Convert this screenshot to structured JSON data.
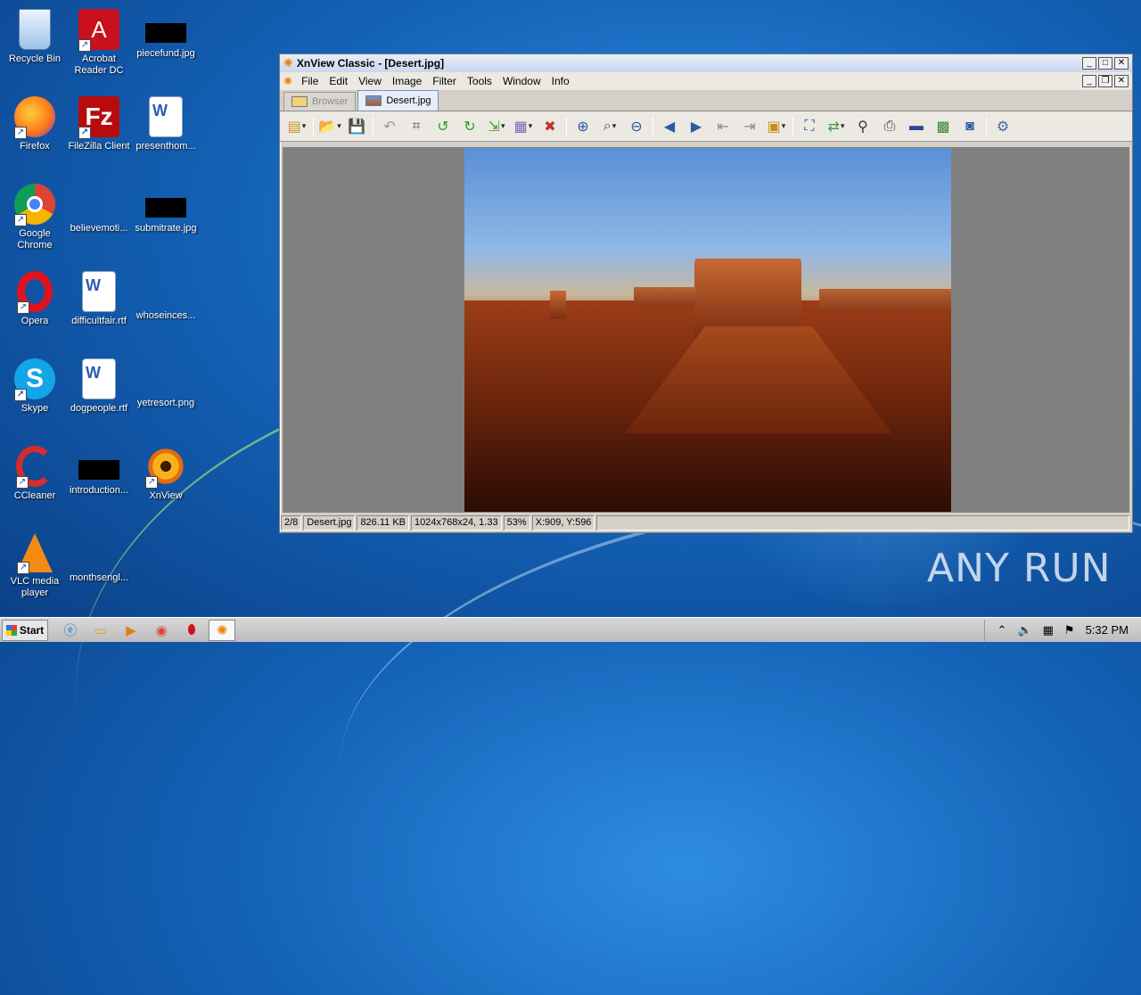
{
  "desktop": {
    "icons": [
      {
        "label": "Recycle Bin"
      },
      {
        "label": "Acrobat Reader DC"
      },
      {
        "label": "piecefund.jpg"
      },
      {
        "label": "Firefox"
      },
      {
        "label": "FileZilla Client"
      },
      {
        "label": "presenthom..."
      },
      {
        "label": "Google Chrome"
      },
      {
        "label": "believemoti..."
      },
      {
        "label": "submitrate.jpg"
      },
      {
        "label": "Opera"
      },
      {
        "label": "difficultfair.rtf"
      },
      {
        "label": "whoseinces..."
      },
      {
        "label": "Skype"
      },
      {
        "label": "dogpeople.rtf"
      },
      {
        "label": "yetresort.png"
      },
      {
        "label": "CCleaner"
      },
      {
        "label": "introduction..."
      },
      {
        "label": "XnView"
      },
      {
        "label": "VLC media player"
      },
      {
        "label": "monthsengl..."
      }
    ]
  },
  "window": {
    "title": "XnView Classic - [Desert.jpg]",
    "menu": [
      "File",
      "Edit",
      "View",
      "Image",
      "Filter",
      "Tools",
      "Window",
      "Info"
    ],
    "tabs": [
      {
        "label": "Browser",
        "active": false
      },
      {
        "label": "Desert.jpg",
        "active": true
      }
    ],
    "statusbar": {
      "index": "2/8",
      "filename": "Desert.jpg",
      "filesize": "826.11 KB",
      "dimensions": "1024x768x24, 1.33",
      "zoom": "53%",
      "cursor": "X:909, Y:596"
    }
  },
  "taskbar": {
    "start_label": "Start",
    "clock": "5:32 PM"
  },
  "watermark": "ANY RUN"
}
